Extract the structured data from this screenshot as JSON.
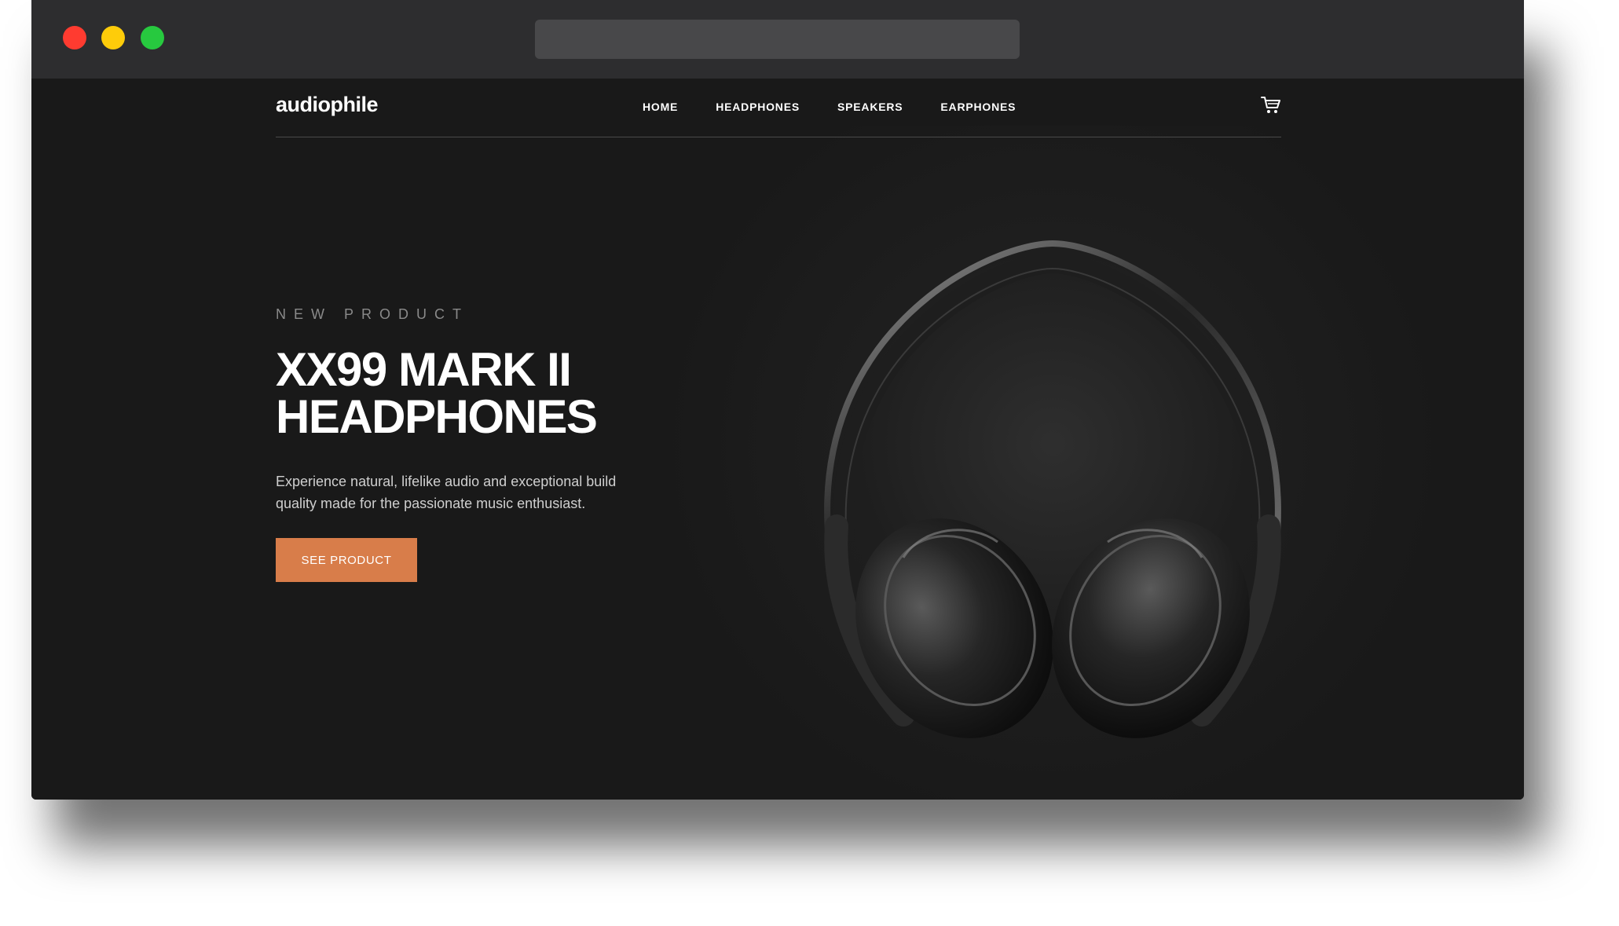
{
  "nav": {
    "logo": "audiophile",
    "items": [
      {
        "label": "HOME"
      },
      {
        "label": "HEADPHONES"
      },
      {
        "label": "SPEAKERS"
      },
      {
        "label": "EARPHONES"
      }
    ],
    "cart_icon": "cart-icon"
  },
  "hero": {
    "overline": "NEW PRODUCT",
    "title_line1": "XX99 MARK II",
    "title_line2": "HEADPHONES",
    "description": "Experience natural, lifelike audio and exceptional build quality made for the passionate music enthusiast.",
    "cta_label": "SEE PRODUCT",
    "image": "headphones-photo"
  },
  "colors": {
    "accent": "#D87D4A",
    "background": "#191919",
    "chrome": "#2D2D2F"
  }
}
